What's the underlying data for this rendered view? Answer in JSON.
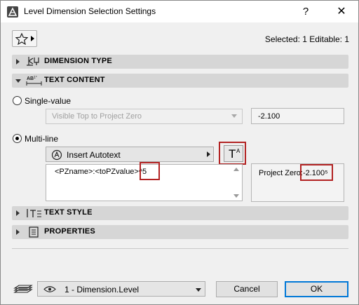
{
  "window": {
    "title": "Level Dimension Selection Settings",
    "help_label": "?",
    "close_label": "✕"
  },
  "header": {
    "selected_info": "Selected: 1 Editable: 1"
  },
  "sections": {
    "dimension_type": "DIMENSION TYPE",
    "text_content": "TEXT CONTENT",
    "text_style": "TEXT STYLE",
    "properties": "PROPERTIES"
  },
  "text_content": {
    "single_value_label": "Single-value",
    "single_value_selected": false,
    "single_value_select": "Visible Top to Project Zero",
    "single_value_value": "-2.100",
    "multi_line_label": "Multi-line",
    "multi_line_selected": true,
    "insert_autotext_label": "Insert Autotext",
    "text_format_button": {
      "main": "T",
      "sup": "A"
    },
    "editor_text": "<PZname>:<toPZvalue>^5",
    "preview_text": "Project Zero:-2.100⁵"
  },
  "footer": {
    "layer_value": "1 - Dimension.Level",
    "cancel_label": "Cancel",
    "ok_label": "OK"
  },
  "colors": {
    "highlight_box": "#b22222",
    "section_bar": "#d6d6d6",
    "ok_border": "#0078d7"
  },
  "icons": [
    "app-icon",
    "star-icon",
    "dimension-type-icon",
    "text-content-icon",
    "autotext-icon",
    "text-style-icon",
    "properties-icon",
    "layer-icon",
    "eye-icon"
  ]
}
